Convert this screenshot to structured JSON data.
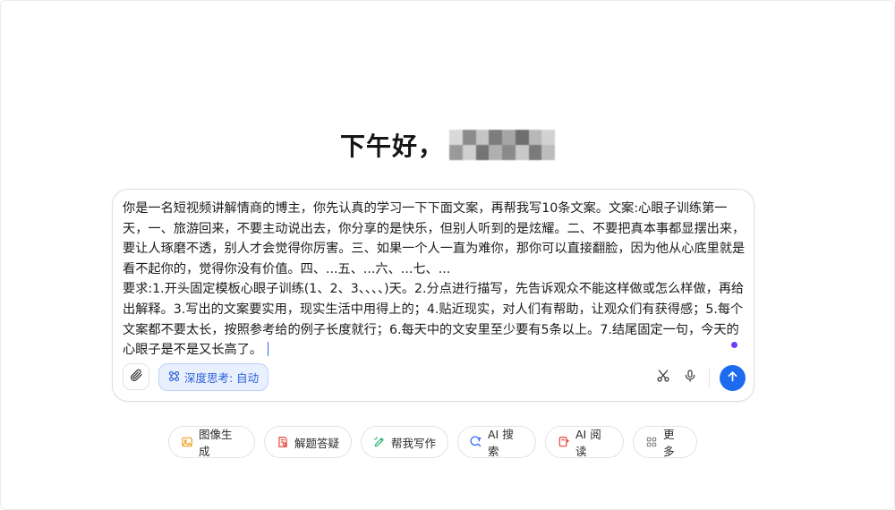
{
  "greeting": {
    "text": "下午好，"
  },
  "prompt": {
    "text": "你是一名短视频讲解情商的博主，你先认真的学习一下下面文案，再帮我写10条文案。文案:心眼子训练第一天，一、旅游回来，不要主动说出去，你分享的是快乐，但别人听到的是炫耀。二、不要把真本事都显摆出来，要让人琢磨不透，别人才会觉得你厉害。三、如果一个人一直为难你，那你可以直接翻脸，因为他从心底里就是看不起你的，觉得你没有价值。四、...五、...六、...七、...\n要求:1.开头固定模板心眼子训练(1、2、3、、、、)天。2.分点进行描写，先告诉观众不能这样做或怎么样做，再给出解释。3.写出的文案要实用，现实生活中用得上的；4.贴近现实，对人们有帮助，让观众们有获得感；5.每个文案都不要太长，按照参考给的例子长度就行；6.每天中的文安里至少要有5条以上。7.结尾固定一句，今天的心眼子是不是又长高了。"
  },
  "toolbar": {
    "deep_think_label": "深度思考: 自动"
  },
  "chips": [
    {
      "label": "图像生成",
      "icon": "image-icon",
      "color": "#f0a020"
    },
    {
      "label": "解题答疑",
      "icon": "qa-icon",
      "color": "#e8453c"
    },
    {
      "label": "帮我写作",
      "icon": "pen-icon",
      "color": "#2bb673"
    },
    {
      "label": "AI 搜索",
      "icon": "search-icon",
      "color": "#2d6cf6"
    },
    {
      "label": "AI 阅读",
      "icon": "reading-icon",
      "color": "#e8453c"
    },
    {
      "label": "更多",
      "icon": "grid-icon",
      "color": "#888888"
    }
  ],
  "colors": {
    "accent": "#1f6bf0",
    "deep_think_bg": "#e8f0fe",
    "cursor_dot": "#6a3df5"
  }
}
